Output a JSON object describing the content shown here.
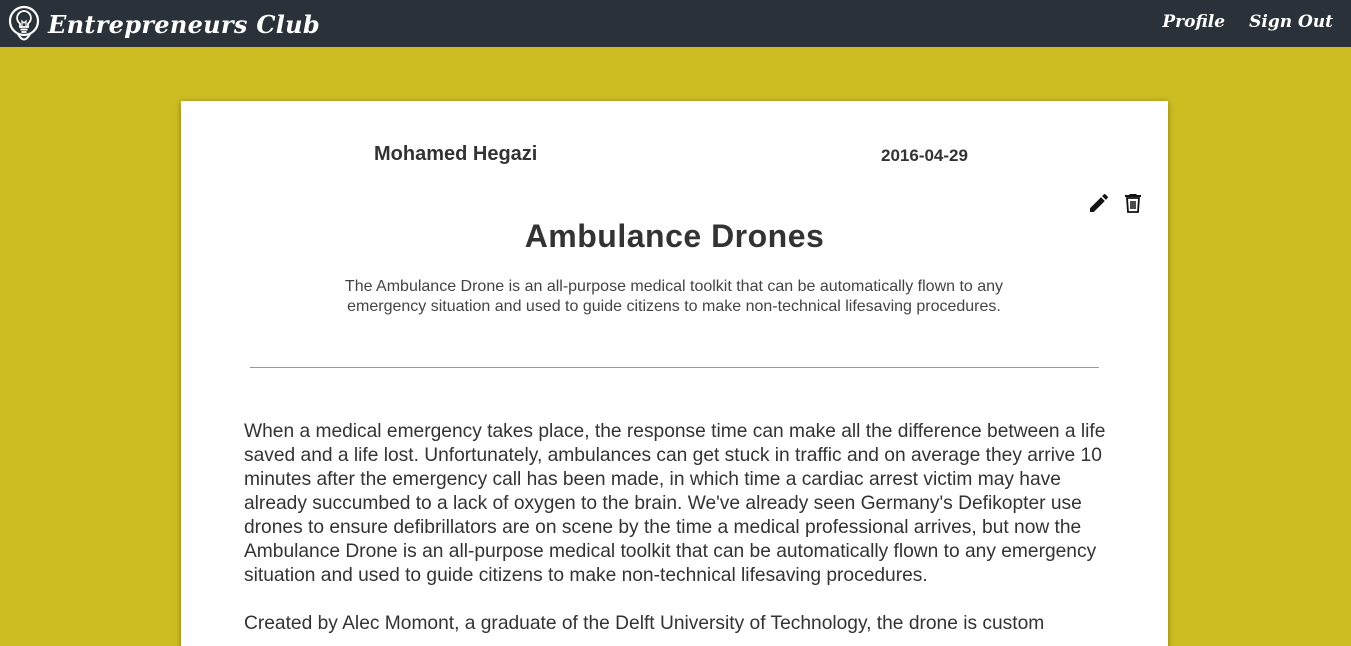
{
  "navbar": {
    "brand": "Entrepreneurs Club",
    "brand_icon": "lightbulb-icon",
    "links": [
      {
        "label": "Profile"
      },
      {
        "label": "Sign Out"
      }
    ],
    "colors": {
      "background": "#2a3138",
      "text": "#ffffff"
    }
  },
  "page": {
    "background": "#cdbd23"
  },
  "post": {
    "author": "Mohamed Hegazi",
    "date": "2016-04-29",
    "title": "Ambulance Drones",
    "summary": "The Ambulance Drone is an all-purpose medical toolkit that can be automatically flown to any emergency situation and used to guide citizens to make non-technical lifesaving procedures.",
    "actions": [
      {
        "icon": "pencil-icon",
        "action": "edit"
      },
      {
        "icon": "trash-icon",
        "action": "delete"
      }
    ],
    "body": [
      "When a medical emergency takes place, the response time can make all the difference between a life saved and a life lost. Unfortunately, ambulances can get stuck in traffic and on average they arrive 10 minutes after the emergency call has been made, in which time a cardiac arrest victim may have already succumbed to a lack of oxygen to the brain. We've already seen Germany's Defikopter use drones to ensure defibrillators are on scene by the time a medical professional arrives, but now the Ambulance Drone is an all-purpose medical toolkit that can be automatically flown to any emergency situation and used to guide citizens to make non-technical lifesaving procedures.",
      "Created by Alec Momont, a graduate of the Delft University of Technology, the drone is custom"
    ]
  }
}
